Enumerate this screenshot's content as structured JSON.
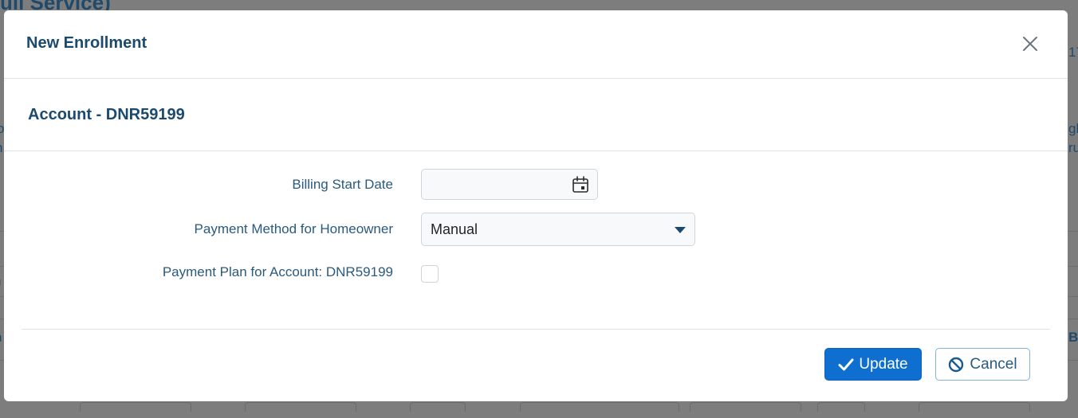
{
  "background": {
    "title_fragment": "ull Service)",
    "right_fragments": [
      "17",
      "gh",
      "ru",
      "Ba"
    ],
    "left_fragments": [
      "o",
      "n",
      "n",
      "n"
    ]
  },
  "modal": {
    "title": "New Enrollment",
    "close_icon": "close-icon",
    "account_heading": "Account - DNR59199",
    "fields": {
      "billing_start_date": {
        "label": "Billing Start Date",
        "value": "",
        "icon": "calendar-icon"
      },
      "payment_method": {
        "label": "Payment Method for Homeowner",
        "selected": "Manual",
        "icon": "caret-down-icon"
      },
      "payment_plan": {
        "label": "Payment Plan for Account: DNR59199",
        "checked": false
      }
    },
    "buttons": {
      "update": {
        "label": "Update",
        "icon": "check-icon",
        "color": "#0f6fd1"
      },
      "cancel": {
        "label": "Cancel",
        "icon": "ban-icon"
      }
    }
  },
  "colors": {
    "heading": "#1b4a6e",
    "label": "#2a5a7d",
    "primary": "#0f6fd1"
  }
}
